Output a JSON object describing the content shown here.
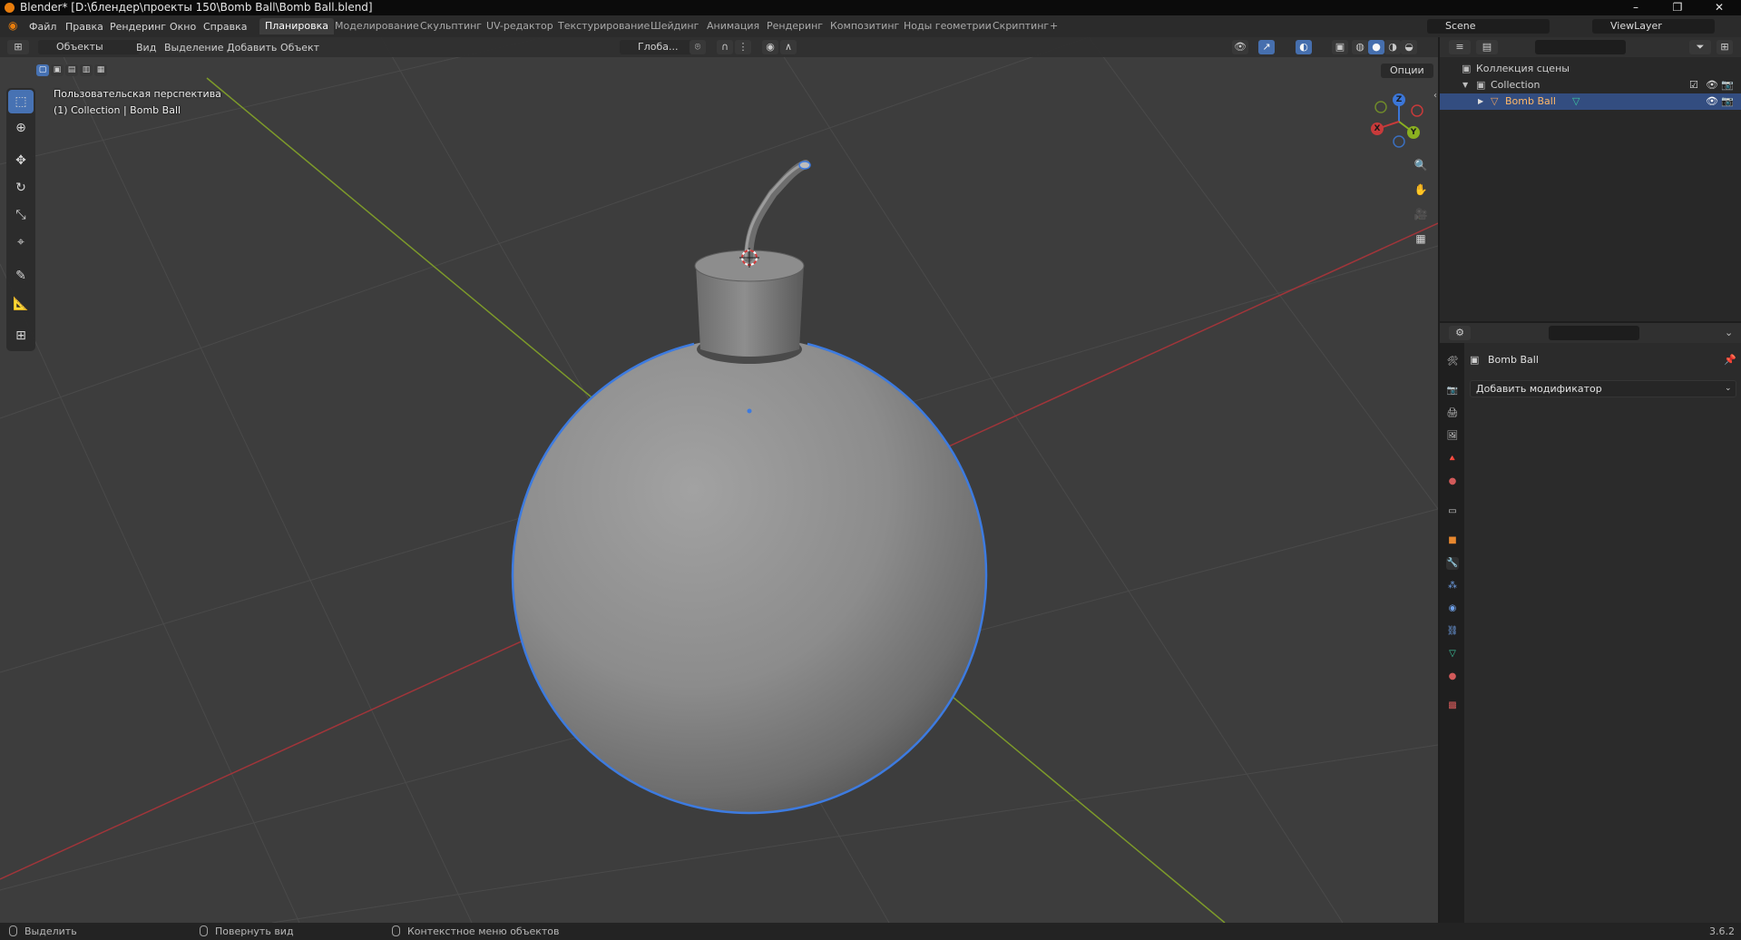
{
  "window": {
    "title": "Blender* [D:\\блендер\\проекты 150\\Bomb Ball\\Bomb Ball.blend]",
    "minimize": "–",
    "maximize": "❐",
    "close": "✕"
  },
  "menus": [
    "Файл",
    "Правка",
    "Рендеринг",
    "Окно",
    "Справка"
  ],
  "workspaces": [
    {
      "label": "Планировка",
      "active": true
    },
    {
      "label": "Моделирование",
      "active": false
    },
    {
      "label": "Скульптинг",
      "active": false
    },
    {
      "label": "UV-редактор",
      "active": false
    },
    {
      "label": "Текстурирование",
      "active": false
    },
    {
      "label": "Шейдинг",
      "active": false
    },
    {
      "label": "Анимация",
      "active": false
    },
    {
      "label": "Рендеринг",
      "active": false
    },
    {
      "label": "Композитинг",
      "active": false
    },
    {
      "label": "Ноды геометрии",
      "active": false
    },
    {
      "label": "Скриптинг",
      "active": false
    }
  ],
  "add_workspace": "+",
  "scene": {
    "name": "Scene",
    "view_layer": "ViewLayer"
  },
  "viewport_header": {
    "mode": "Объекты",
    "menus": [
      "Вид",
      "Выделение",
      "Добавить",
      "Объект"
    ],
    "orientation": "Глоба...",
    "options": "Опции"
  },
  "viewport_overlay": {
    "view_name": "Пользовательская перспектива",
    "collection_info": "(1) Collection | Bomb Ball"
  },
  "gizmo": {
    "z": "Z",
    "y": "Y",
    "x": "X"
  },
  "outliner": {
    "root": "Коллекция сцены",
    "collection": "Collection",
    "object": "Bomb Ball"
  },
  "properties": {
    "object_name": "Bomb Ball",
    "add_modifier": "Добавить модификатор"
  },
  "status_bar": {
    "select": "Выделить",
    "rotate": "Повернуть вид",
    "context": "Контекстное меню объектов",
    "version": "3.6.2"
  },
  "colors": {
    "accent": "#4772b3",
    "selection_outline": "#3d7be0",
    "x_axis": "#c83a3a",
    "y_axis": "#8ab020",
    "z_axis": "#3b76d8"
  }
}
